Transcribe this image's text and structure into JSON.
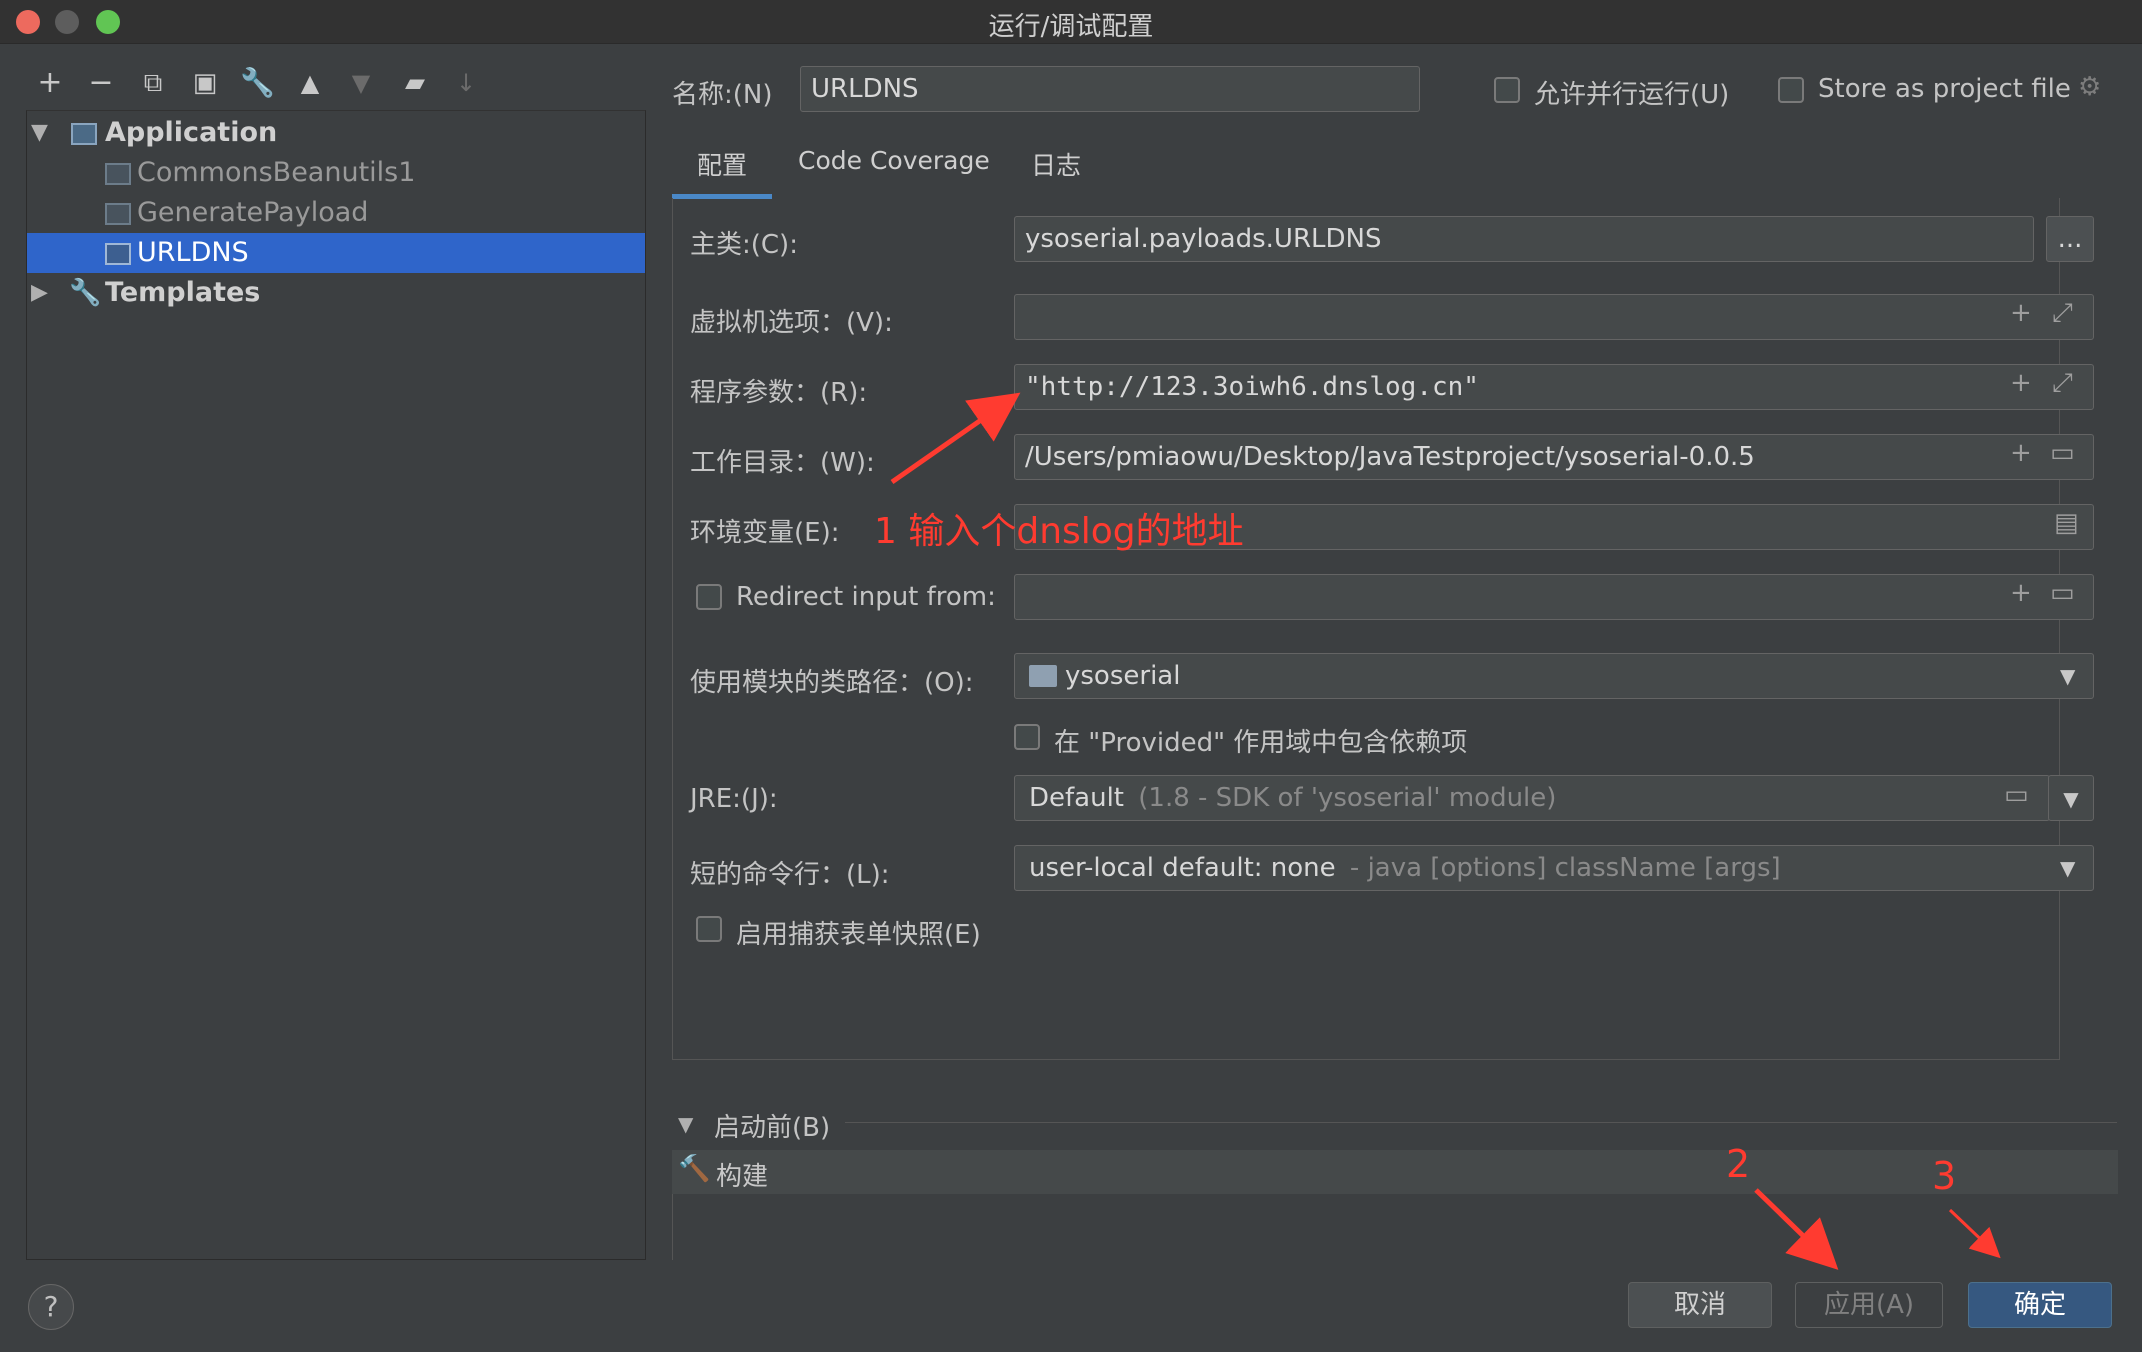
{
  "window": {
    "title": "运行/调试配置"
  },
  "tree": {
    "application": "Application",
    "items": [
      "CommonsBeanutils1",
      "GeneratePayload",
      "URLDNS"
    ],
    "templates": "Templates"
  },
  "header": {
    "name_label": "名称:(N)",
    "name_value": "URLDNS",
    "parallel_label": "允许并行运行(U)",
    "store_label": "Store as project file"
  },
  "tabs": [
    "配置",
    "Code Coverage",
    "日志"
  ],
  "form": {
    "main_class_label": "主类:(C):",
    "main_class_value": "ysoserial.payloads.URLDNS",
    "browse_label": "...",
    "vm_label": "虚拟机选项：(V):",
    "vm_value": "",
    "args_label": "程序参数：(R):",
    "args_value": "\"http://123.3oiwh6.dnslog.cn\"",
    "workdir_label": "工作目录：(W):",
    "workdir_value": "/Users/pmiaowu/Desktop/JavaTestproject/ysoserial-0.0.5",
    "env_label": "环境变量(E):",
    "env_value": "",
    "redirect_label": "Redirect input from:",
    "redirect_value": "",
    "module_label": "使用模块的类路径：(O):",
    "module_value": "ysoserial",
    "provided_label": "在 \"Provided\" 作用域中包含依赖项",
    "jre_label": "JRE:(J):",
    "jre_value": "Default",
    "jre_hint": "(1.8 - SDK of 'ysoserial' module)",
    "shortcmd_label": "短的命令行：(L):",
    "shortcmd_value": "user-local default: none",
    "shortcmd_hint": "- java [options] className [args]",
    "snapshot_label": "启用捕获表单快照(E)"
  },
  "before_launch": {
    "label": "启动前(B)",
    "item": "构建"
  },
  "buttons": {
    "cancel": "取消",
    "apply": "应用(A)",
    "ok": "确定",
    "help": "?"
  },
  "annotations": {
    "step1": "1 输入个dnslog的地址",
    "step2": "2",
    "step3": "3"
  },
  "colors": {
    "accent": "#2f65ca",
    "annotation": "#ff3b30",
    "ok_button": "#365880"
  }
}
